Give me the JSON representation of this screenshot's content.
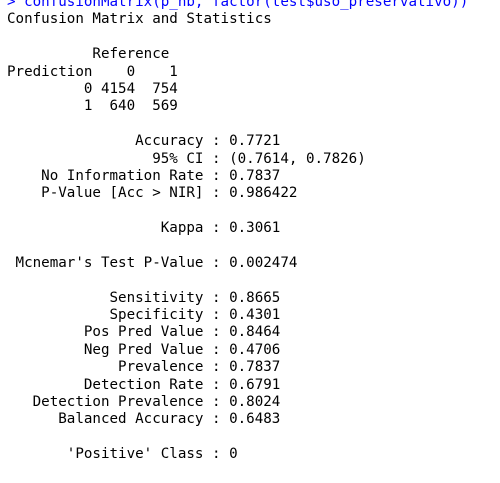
{
  "console": {
    "command_line": "> confusionMatrix(p_nb, factor(test$uso_preservativo))",
    "lines": [
      "Confusion Matrix and Statistics",
      "",
      "          Reference",
      "Prediction    0    1",
      "         0 4154  754",
      "         1  640  569",
      "",
      "               Accuracy : 0.7721",
      "                 95% CI : (0.7614, 0.7826)",
      "    No Information Rate : 0.7837",
      "    P-Value [Acc > NIR] : 0.986422",
      "",
      "                  Kappa : 0.3061",
      "",
      " Mcnemar's Test P-Value : 0.002474",
      "",
      "            Sensitivity : 0.8665",
      "            Specificity : 0.4301",
      "         Pos Pred Value : 0.8464",
      "         Neg Pred Value : 0.4706",
      "             Prevalence : 0.7837",
      "         Detection Rate : 0.6791",
      "   Detection Prevalence : 0.8024",
      "      Balanced Accuracy : 0.6483",
      "",
      "       'Positive' Class : 0",
      "",
      ""
    ]
  },
  "colors": {
    "command": "#0000ff",
    "output": "#000000",
    "background": "#ffffff"
  }
}
